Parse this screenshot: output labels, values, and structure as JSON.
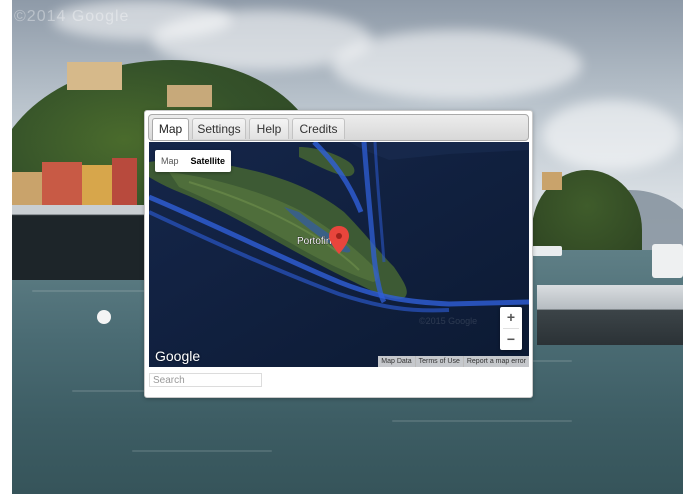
{
  "streetview": {
    "watermark": "©2014 Google"
  },
  "panel": {
    "tabs": [
      {
        "label": "Map",
        "active": true
      },
      {
        "label": "Settings",
        "active": false
      },
      {
        "label": "Help",
        "active": false
      },
      {
        "label": "Credits",
        "active": false
      }
    ],
    "map": {
      "type_options": {
        "map": "Map",
        "satellite": "Satellite"
      },
      "selected_type": "Satellite",
      "place_label": "Portofino",
      "marker_color": "#e8453c",
      "watermark": "©2015 Google",
      "logo": "Google",
      "zoom": {
        "in": "+",
        "out": "−"
      },
      "attribution": {
        "map_data": "Map Data",
        "terms": "Terms of Use",
        "report": "Report a map error"
      }
    },
    "search": {
      "placeholder": "Search",
      "value": ""
    }
  }
}
